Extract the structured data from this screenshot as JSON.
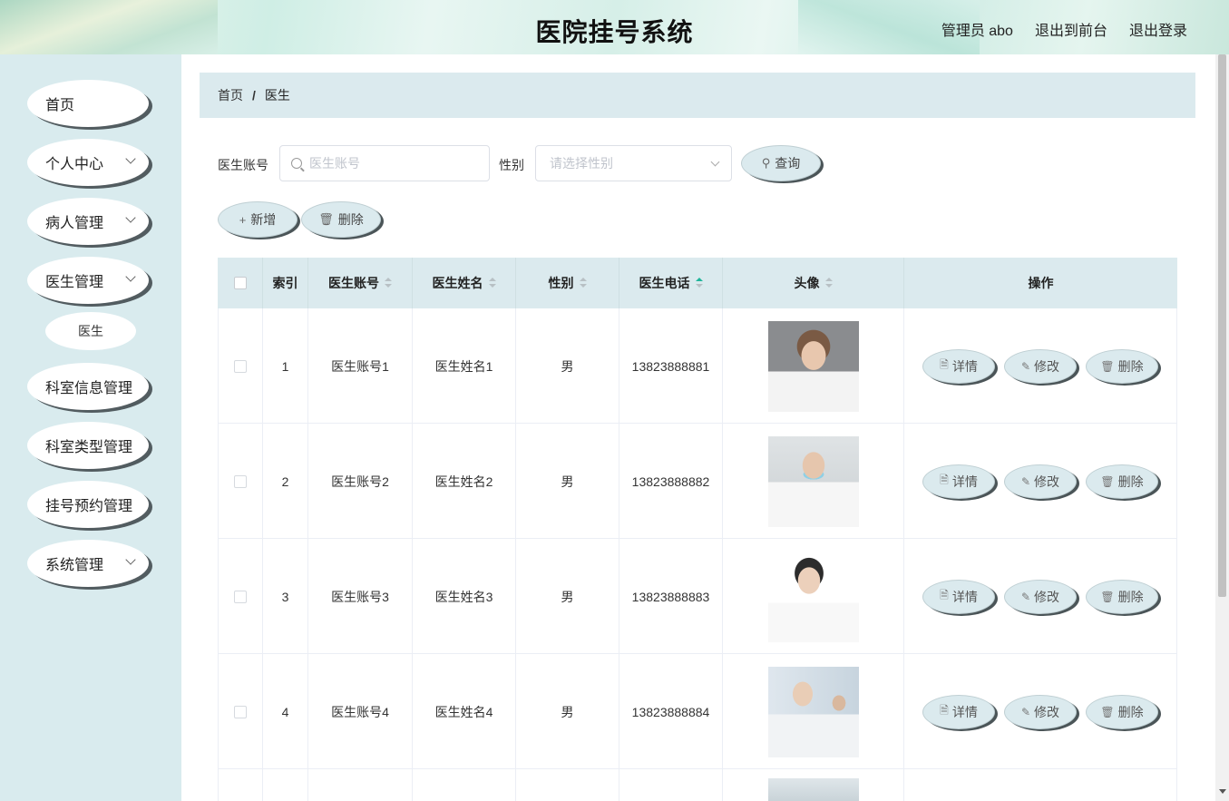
{
  "header": {
    "title": "医院挂号系统",
    "admin_label": "管理员 abo",
    "to_front": "退出到前台",
    "logout": "退出登录"
  },
  "sidebar": {
    "items": [
      {
        "label": "首页",
        "expandable": false
      },
      {
        "label": "个人中心",
        "expandable": true
      },
      {
        "label": "病人管理",
        "expandable": true
      },
      {
        "label": "医生管理",
        "expandable": true
      },
      {
        "label": "科室信息管理",
        "expandable": false
      },
      {
        "label": "科室类型管理",
        "expandable": false
      },
      {
        "label": "挂号预约管理",
        "expandable": false
      },
      {
        "label": "系统管理",
        "expandable": true
      }
    ],
    "sub_item": "医生"
  },
  "breadcrumb": {
    "home": "首页",
    "sep": "/",
    "current": "医生"
  },
  "search": {
    "account_label": "医生账号",
    "account_placeholder": "医生账号",
    "gender_label": "性别",
    "gender_placeholder": "请选择性别",
    "query_button": "查询"
  },
  "toolbar": {
    "add": "新增",
    "delete": "删除"
  },
  "table": {
    "headers": {
      "index": "索引",
      "account": "医生账号",
      "name": "医生姓名",
      "gender": "性别",
      "phone": "医生电话",
      "avatar": "头像",
      "actions": "操作"
    },
    "rows": [
      {
        "index": "1",
        "account": "医生账号1",
        "name": "医生姓名1",
        "gender": "男",
        "phone": "13823888881"
      },
      {
        "index": "2",
        "account": "医生账号2",
        "name": "医生姓名2",
        "gender": "男",
        "phone": "13823888882"
      },
      {
        "index": "3",
        "account": "医生账号3",
        "name": "医生姓名3",
        "gender": "男",
        "phone": "13823888883"
      },
      {
        "index": "4",
        "account": "医生账号4",
        "name": "医生姓名4",
        "gender": "男",
        "phone": "13823888884"
      }
    ],
    "row_actions": {
      "detail": "详情",
      "edit": "修改",
      "delete": "删除"
    }
  },
  "colors": {
    "accent": "#dbeaee",
    "sidebar_bg": "#d9ebee",
    "sort_active": "#1fb59a"
  }
}
